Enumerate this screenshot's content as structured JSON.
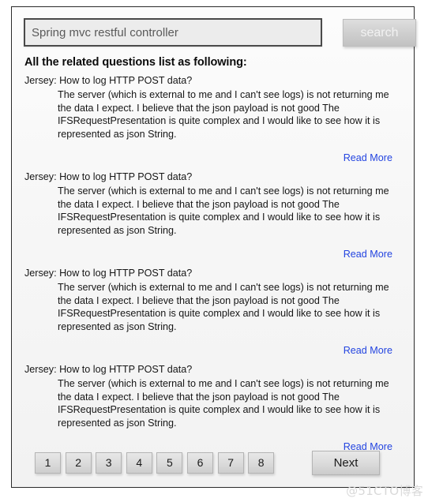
{
  "search": {
    "value": "Spring mvc restful controller",
    "placeholder": "Spring mvc restful controller",
    "button_label": "search"
  },
  "heading": "All the related questions list as following:",
  "results": [
    {
      "title": "Jersey: How to log HTTP POST data?",
      "snippet": "The server (which is external to me and I can't see logs) is not returning me the data I expect. I believe that the json payload is not good The IFSRequestPresentation is quite complex and I would like to see how it is represented as json String.",
      "read_more": "Read More"
    },
    {
      "title": "Jersey: How to log HTTP POST data?",
      "snippet": "The server (which is external to me and I can't see logs) is not returning me the data I expect. I believe that the json payload is not good The IFSRequestPresentation is quite complex and I would like to see how it is represented as json String.",
      "read_more": "Read More"
    },
    {
      "title": "Jersey: How to log HTTP POST data?",
      "snippet": "The server (which is external to me and I can't see logs) is not returning me the data I expect. I believe that the json payload is not good The IFSRequestPresentation is quite complex and I would like to see how it is represented as json String.",
      "read_more": "Read More"
    },
    {
      "title": "Jersey: How to log HTTP POST data?",
      "snippet": "The server (which is external to me and I can't see logs) is not returning me the data I expect. I believe that the json payload is not good The IFSRequestPresentation is quite complex and I would like to see how it is represented as json String.",
      "read_more": "Read More"
    }
  ],
  "pagination": {
    "pages": [
      "1",
      "2",
      "3",
      "4",
      "5",
      "6",
      "7",
      "8"
    ],
    "next_label": "Next"
  },
  "watermark": "@51CTO博客",
  "colors": {
    "link": "#2344e0",
    "frame_border": "#2b2b2b",
    "input_border": "#4a4a4a",
    "button_face": "#dcdcdc",
    "watermark": "#d9d9d9"
  }
}
